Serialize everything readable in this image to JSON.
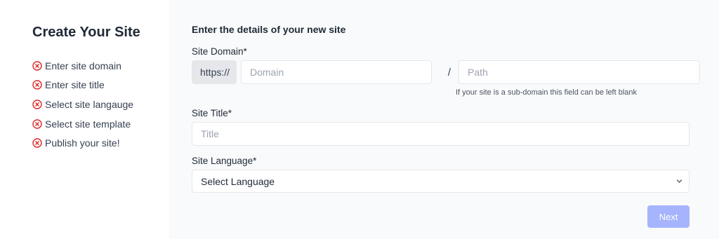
{
  "sidebar": {
    "title": "Create Your Site",
    "steps": [
      {
        "label": "Enter site domain",
        "icon": "x-circle-icon",
        "status": "incomplete"
      },
      {
        "label": "Enter site title",
        "icon": "x-circle-icon",
        "status": "incomplete"
      },
      {
        "label": "Select site langauge",
        "icon": "x-circle-icon",
        "status": "incomplete"
      },
      {
        "label": "Select site template",
        "icon": "x-circle-icon",
        "status": "incomplete"
      },
      {
        "label": "Publish your site!",
        "icon": "x-circle-icon",
        "status": "incomplete"
      }
    ]
  },
  "form": {
    "heading": "Enter the details of your new site",
    "domain": {
      "label": "Site Domain*",
      "prefix": "https://",
      "placeholder": "Domain",
      "value": "",
      "separator": "/",
      "path_placeholder": "Path",
      "path_value": "",
      "hint": "If your site is a sub-domain this field can be left blank"
    },
    "title": {
      "label": "Site Title*",
      "placeholder": "Title",
      "value": ""
    },
    "language": {
      "label": "Site Language*",
      "selected": "Select Language"
    },
    "next_label": "Next"
  },
  "colors": {
    "error_icon": "#dc2626",
    "sidebar_bg": "#ffffff",
    "main_bg": "#f9fafb",
    "prefix_bg": "#e5e7eb",
    "button_disabled": "#a5b4fc"
  }
}
